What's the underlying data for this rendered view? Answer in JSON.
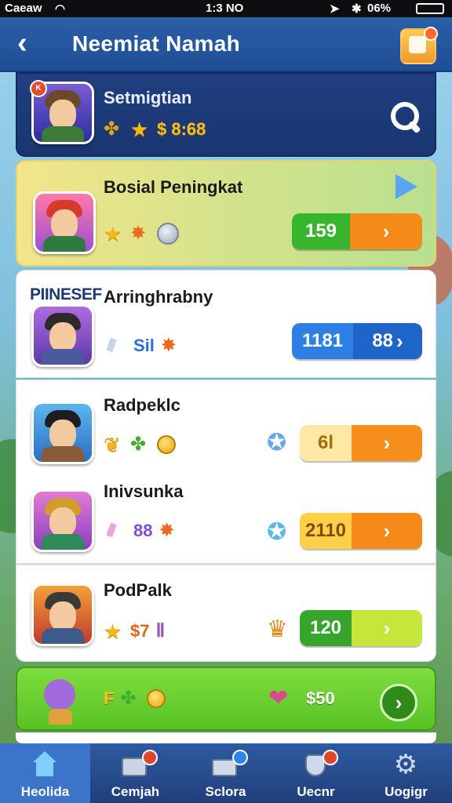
{
  "status_bar": {
    "carrier": "Caeaw",
    "time": "1:3 NO",
    "battery": "06%"
  },
  "header": {
    "title": "Neemiat Namah",
    "back_icon": "chevron-left-icon",
    "corner_icon": "quest-icon"
  },
  "profile": {
    "name": "Setmigtian",
    "value": "$ 8:68",
    "icons": [
      "clover-icon",
      "star-icon"
    ]
  },
  "rows": [
    {
      "name": "Bosial Peningkat",
      "pill": {
        "left": "159",
        "right": ""
      },
      "icons": [
        "star-icon",
        "flame-icon",
        "silver-coin-icon"
      ],
      "badge_top": "K",
      "colors": {
        "pill_left": "#38b52d",
        "pill_right": "#f48a1a"
      }
    },
    {
      "prefix": "PIINESEF",
      "name": "Arringhrabny",
      "value": "Sil",
      "pill": {
        "left": "1181",
        "right": "88"
      },
      "icons": [
        "crystal-icon",
        "flame-icon"
      ],
      "colors": {
        "pill_left": "#2d7fe3",
        "pill_right": "#1f64c9"
      }
    },
    {
      "name": "Radpeklc",
      "pill": {
        "left": "6l",
        "right": ""
      },
      "icons": [
        "leaf-icon",
        "clover-icon",
        "coin-icon"
      ],
      "item_icon": "hero-icon",
      "colors": {
        "pill_left": "#ffe8a6",
        "pill_right": "#f58e1c"
      }
    },
    {
      "name": "Inivsunka",
      "value": "88",
      "pill": {
        "left": "2110",
        "right": ""
      },
      "icons": [
        "crystal-icon",
        "flame-icon"
      ],
      "item_icon": "hero-icon",
      "colors": {
        "pill_left": "#ffcf4a",
        "pill_right": "#f58a1a"
      }
    },
    {
      "name": "PodPalk",
      "value": "$7",
      "pill": {
        "left": "120",
        "right": ""
      },
      "icons": [
        "star-icon",
        "rainbow-icon"
      ],
      "item_icon": "trophy-icon",
      "colors": {
        "pill_left": "#37a52b",
        "pill_right": "#c5e63a"
      }
    },
    {
      "value_left": "F",
      "value": "$50",
      "icons": [
        "clover-icon",
        "coin-icon"
      ],
      "item_icon": "heart-icon"
    }
  ],
  "nav": [
    {
      "label": "Heolida",
      "icon": "home-icon",
      "active": true
    },
    {
      "label": "Cemjah",
      "icon": "chest-icon",
      "active": false
    },
    {
      "label": "Sclora",
      "icon": "mail-icon",
      "active": false
    },
    {
      "label": "Uecnr",
      "icon": "shield-icon",
      "active": false
    },
    {
      "label": "Uogigr",
      "icon": "gear-icon",
      "active": false
    }
  ]
}
